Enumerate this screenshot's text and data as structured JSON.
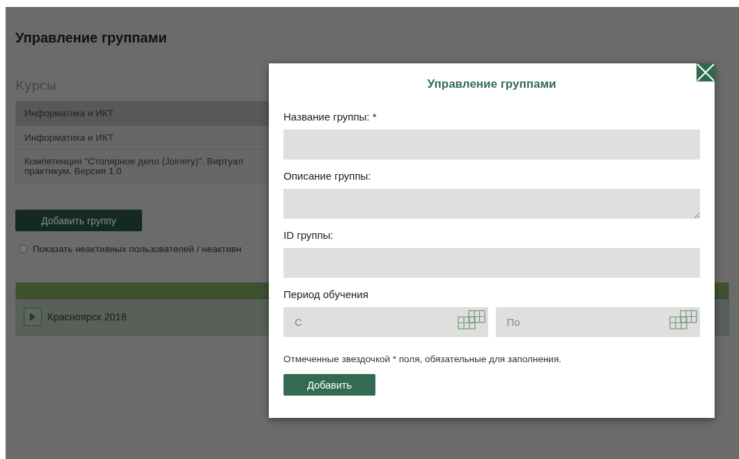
{
  "page": {
    "title": "Управление группами",
    "courses_heading": "Курсы",
    "courses": [
      {
        "name": "Информатика и ИКТ",
        "selected": true
      },
      {
        "name": "Информатика и ИКТ",
        "selected": false
      },
      {
        "name": "Компетенция \"Столярное дело (Joinery)\". Виртуал",
        "name_line_2": "практикум. Версия 1.0",
        "selected": false
      }
    ],
    "add_group_button": "Добавить группу",
    "show_inactive": {
      "label": "Показать неактивных пользователей / неактивн",
      "checked": false
    },
    "groups": [
      {
        "name": "Красноярск 2018",
        "expanded": false
      }
    ]
  },
  "dialog": {
    "title": "Управление группами",
    "fields": [
      {
        "label": "Название группы: *",
        "kind": "input"
      },
      {
        "label": "Описание группы:",
        "kind": "textarea"
      },
      {
        "label": "ID группы:",
        "kind": "input"
      }
    ],
    "period": {
      "label": "Период обучения",
      "from_placeholder": "С",
      "to_placeholder": "По"
    },
    "note": "Отмеченные звездочкой * поля, обязательные для заполнения.",
    "submit": "Добавить"
  }
}
